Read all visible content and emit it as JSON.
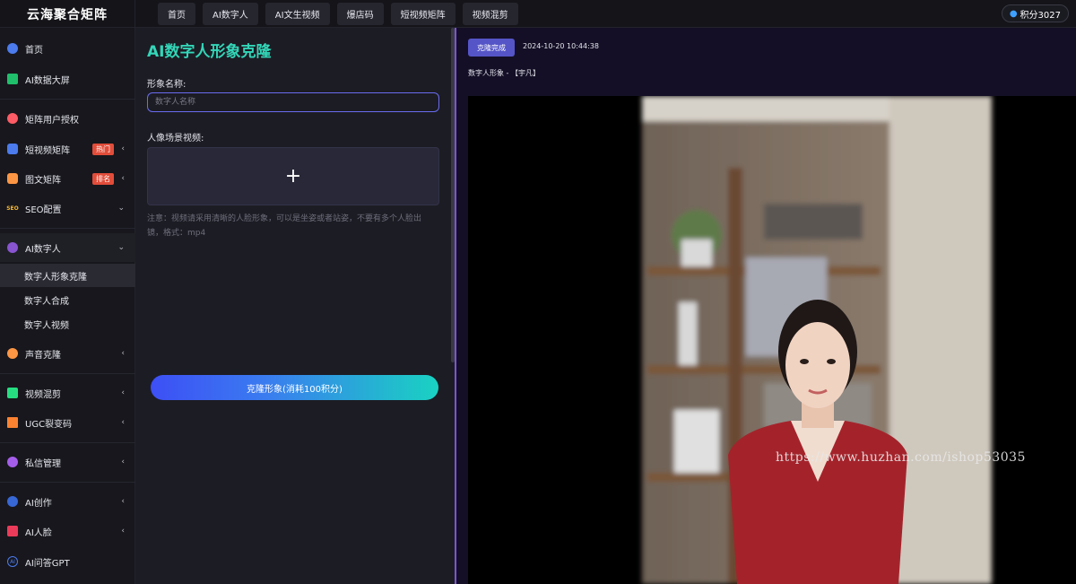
{
  "brand": "云海聚合矩阵",
  "topnav": [
    "首页",
    "AI数字人",
    "AI文生视频",
    "爆店码",
    "短视频矩阵",
    "视频混剪"
  ],
  "points": "积分3027",
  "sidebar": {
    "items": [
      {
        "label": "首页",
        "icon_color": "#4b7bec"
      },
      {
        "label": "AI数据大屏",
        "icon_color": "#20bf6b"
      },
      {
        "label": "矩阵用户授权",
        "icon_color": "#fc5c65"
      },
      {
        "label": "短视频矩阵",
        "icon_color": "#4b7bec",
        "badge": "热门"
      },
      {
        "label": "图文矩阵",
        "icon_color": "#fd9644",
        "badge": "排名"
      },
      {
        "label": "SEO配置",
        "icon_color": "#f7b731",
        "icon_text": "SEO"
      },
      {
        "label": "AI数字人",
        "icon_color": "#8854d0"
      },
      {
        "label": "声音克隆",
        "icon_color": "#fd9644"
      },
      {
        "label": "视频混剪",
        "icon_color": "#26de81"
      },
      {
        "label": "UGC裂变码",
        "icon_color": "#fa8231"
      },
      {
        "label": "私信管理",
        "icon_color": "#a55eea"
      },
      {
        "label": "AI创作",
        "icon_color": "#3867d6"
      },
      {
        "label": "AI人脸",
        "icon_color": "#eb3b5a"
      },
      {
        "label": "AI问答GPT",
        "icon_color": "#3867d6",
        "icon_text": "AI"
      }
    ],
    "sub_items": [
      "数字人形象克隆",
      "数字人合成",
      "数字人视频"
    ]
  },
  "form": {
    "title": "AI数字人形象克隆",
    "name_label": "形象名称:",
    "name_placeholder": "数字人名称",
    "video_label": "人像场景视频:",
    "upload_symbol": "+",
    "notice": "注意：视频请采用清晰的人脸形象，可以是坐姿或者站姿，不要有多个人脸出镜，格式：mp4",
    "submit": "克隆形象(消耗100积分)"
  },
  "result": {
    "status": "克隆完成",
    "timestamp": "2024-10-20 10:44:38",
    "avatar_label": "数字人形象 - 【宇凡】",
    "watermark": "https://www.huzhan.com/ishop53035"
  }
}
